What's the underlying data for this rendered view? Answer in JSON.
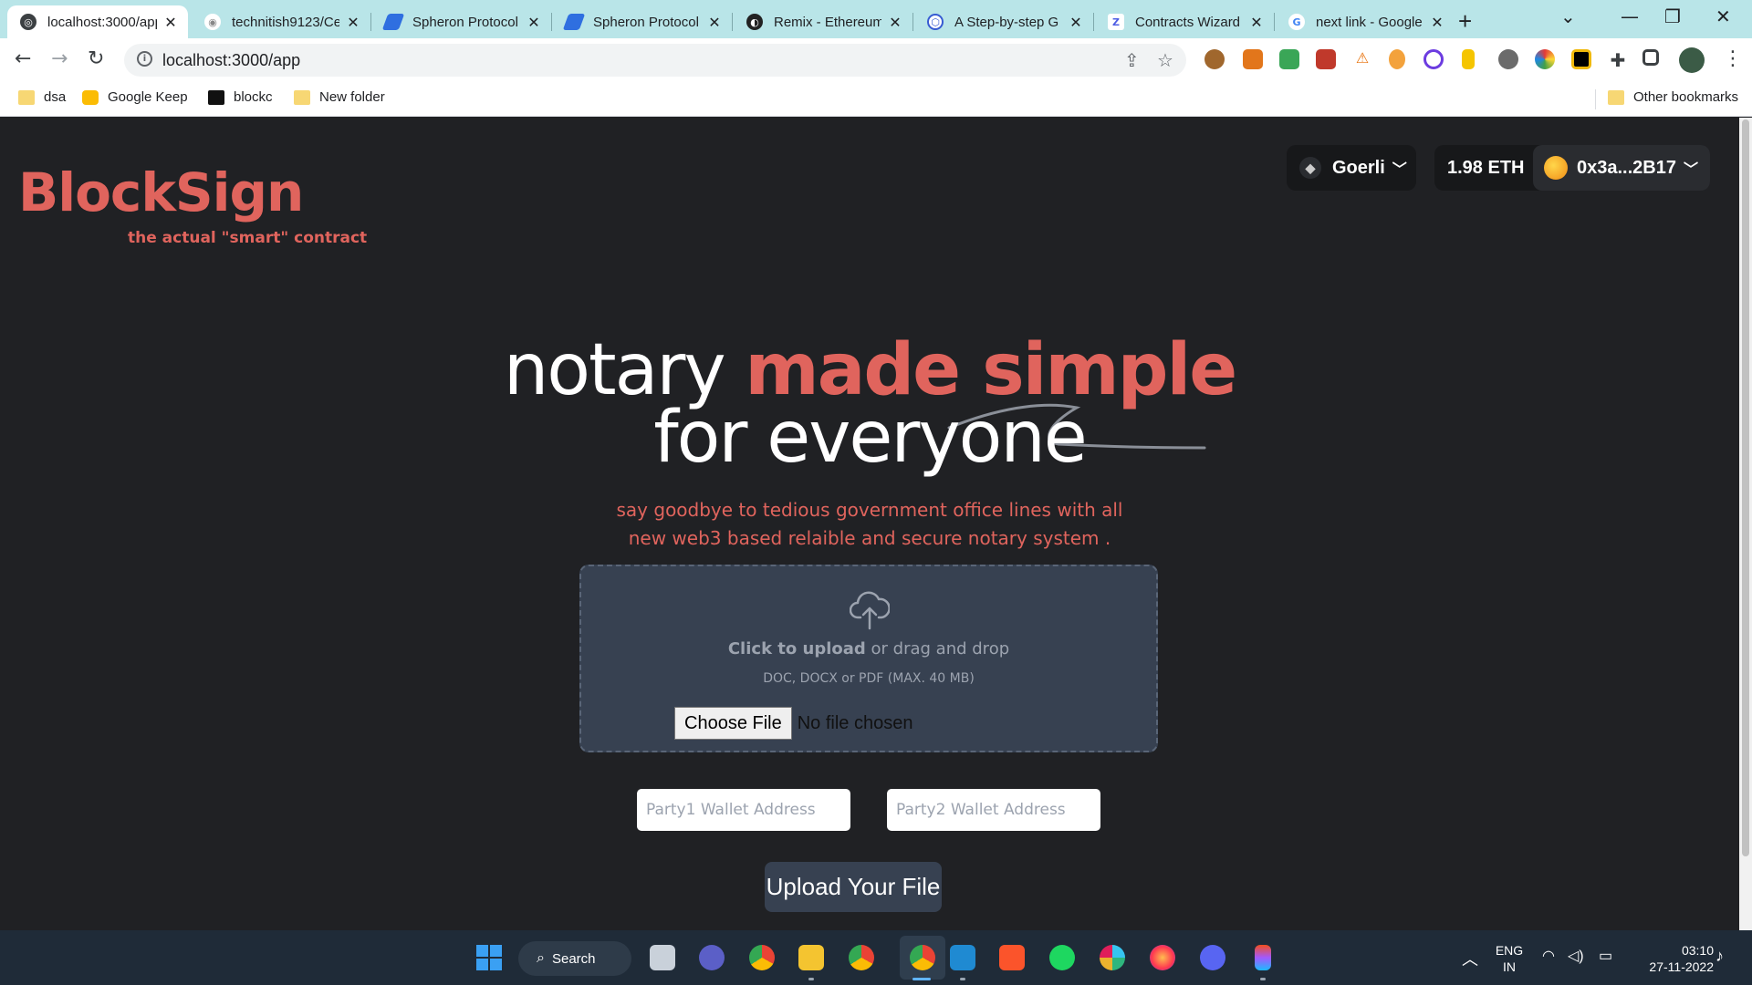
{
  "browser": {
    "tabs": [
      {
        "title": "localhost:3000/app",
        "active": true,
        "icon": "globe-icon"
      },
      {
        "title": "technitish9123/Ce",
        "active": false,
        "icon": "github-icon"
      },
      {
        "title": "Spheron Protocol",
        "active": false,
        "icon": "spheron-icon"
      },
      {
        "title": "Spheron Protocol",
        "active": false,
        "icon": "spheron-icon"
      },
      {
        "title": "Remix - Ethereum",
        "active": false,
        "icon": "remix-icon"
      },
      {
        "title": "A Step-by-step G",
        "active": false,
        "icon": "chain-icon"
      },
      {
        "title": "Contracts Wizard",
        "active": false,
        "icon": "openzeppelin-icon"
      },
      {
        "title": "next link - Google",
        "active": false,
        "icon": "google-icon"
      }
    ],
    "new_tab": "+",
    "url": "localhost:3000/app",
    "bookmarks": [
      {
        "label": "dsa",
        "icon": "folder-icon"
      },
      {
        "label": "Google Keep",
        "icon": "keep-icon"
      },
      {
        "label": "blockc",
        "icon": "blockc-icon"
      },
      {
        "label": "New folder",
        "icon": "folder-icon"
      }
    ],
    "other_bookmarks": "Other bookmarks"
  },
  "app": {
    "brand": "BlockSign",
    "tagline": "the actual \"smart\" contract",
    "network": {
      "name": "Goerli",
      "icon": "ethereum-icon"
    },
    "balance": "1.98 ETH",
    "account": "0x3a...2B17",
    "hero": {
      "line1_plain": "notary ",
      "line1_accent": "made simple",
      "line2": "for everyone"
    },
    "subtitle_line1": "say goodbye to tedious government office lines with all",
    "subtitle_line2": "new web3 based relaible and secure notary system .",
    "upload": {
      "click_label": "Click to upload",
      "drag_label": " or drag and drop",
      "hint": "DOC, DOCX or PDF (MAX. 40 MB)",
      "choose_file": "Choose File",
      "no_file": "No file chosen"
    },
    "party1_placeholder": "Party1 Wallet Address",
    "party2_placeholder": "Party2 Wallet Address",
    "submit_label": "Upload Your File"
  },
  "taskbar": {
    "search_label": "Search",
    "lang_top": "ENG",
    "lang_bottom": "IN",
    "time": "03:10",
    "date": "27-11-2022"
  },
  "colors": {
    "accent": "#e0645d",
    "page_bg": "#202124",
    "dropzone_bg": "#374151",
    "tabstrip_bg": "#b9e5e8",
    "taskbar_bg": "#1f2b38"
  }
}
